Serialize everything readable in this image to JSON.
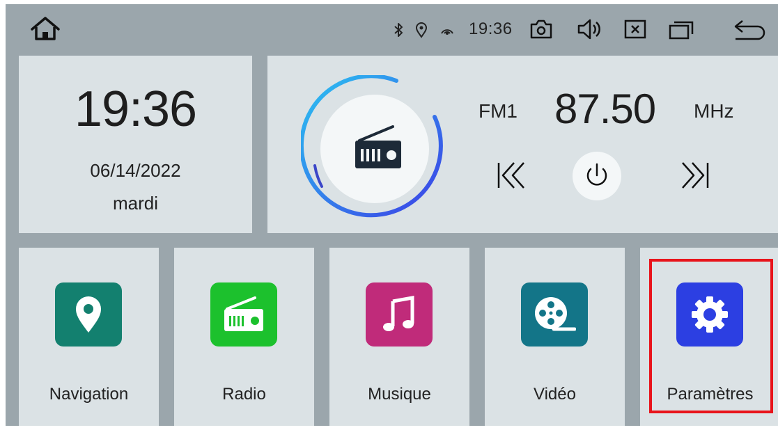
{
  "status_bar": {
    "time": "19:36",
    "icons": [
      "home-icon",
      "bluetooth-icon",
      "location-icon",
      "signal-icon",
      "camera-icon",
      "volume-icon",
      "close-window-icon",
      "recent-apps-icon",
      "back-icon"
    ]
  },
  "clock": {
    "time": "19:36",
    "date": "06/14/2022",
    "day": "mardi"
  },
  "radio": {
    "band": "FM1",
    "frequency": "87.50",
    "unit": "MHz",
    "icon": "radio-icon",
    "controls": [
      "previous-icon",
      "power-icon",
      "next-icon"
    ]
  },
  "apps": [
    {
      "label": "Navigation",
      "icon": "map-pin-icon",
      "color": "#13806f"
    },
    {
      "label": "Radio",
      "icon": "radio-icon",
      "color": "#1cc12d"
    },
    {
      "label": "Musique",
      "icon": "music-note-icon",
      "color": "#c02b7a"
    },
    {
      "label": "Vidéo",
      "icon": "film-reel-icon",
      "color": "#137588"
    },
    {
      "label": "Paramètres",
      "icon": "gear-icon",
      "color": "#2c3fe2"
    }
  ],
  "colors": {
    "background": "#9ba6ac",
    "panel": "#dbe2e5",
    "highlight": "#e8141b",
    "dial_gradient_start": "#2bc3f1",
    "dial_gradient_end": "#3c3fe6"
  },
  "highlighted_app": "Paramètres"
}
